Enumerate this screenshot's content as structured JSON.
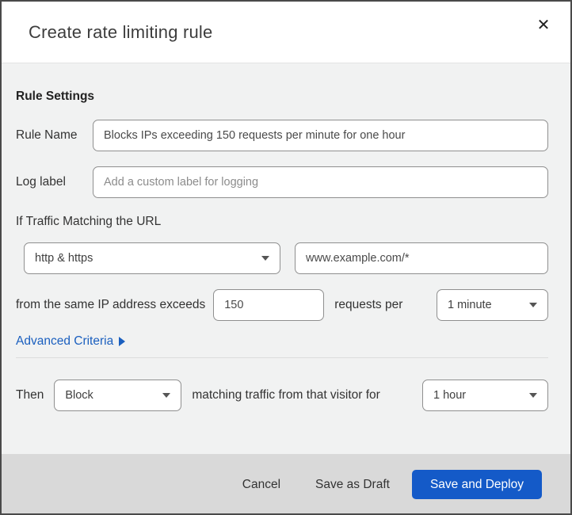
{
  "modal": {
    "title": "Create rate limiting rule",
    "close_icon": "✕"
  },
  "rule_settings": {
    "heading": "Rule Settings",
    "rule_name": {
      "label": "Rule Name",
      "value": "Blocks IPs exceeding 150 requests per minute for one hour"
    },
    "log_label": {
      "label": "Log label",
      "placeholder": "Add a custom label for logging"
    },
    "traffic_match": {
      "heading": "If Traffic Matching the URL",
      "scheme_selected": "http & https",
      "url_value": "www.example.com/*",
      "threshold_prefix": "from the same IP address exceeds",
      "threshold_value": "150",
      "threshold_suffix": "requests per",
      "period_selected": "1 minute"
    },
    "advanced_criteria_label": "Advanced Criteria"
  },
  "action": {
    "prefix": "Then",
    "action_selected": "Block",
    "middle_text": "matching traffic from that visitor for",
    "duration_selected": "1 hour"
  },
  "footer": {
    "cancel_label": "Cancel",
    "save_draft_label": "Save as Draft",
    "save_deploy_label": "Save and Deploy"
  },
  "colors": {
    "primary_blue": "#145ac8",
    "link_blue": "#1a5fbf",
    "body_bg": "#f1f2f2",
    "footer_bg": "#d9d9d9",
    "page_strip": "#0f1e2e"
  }
}
